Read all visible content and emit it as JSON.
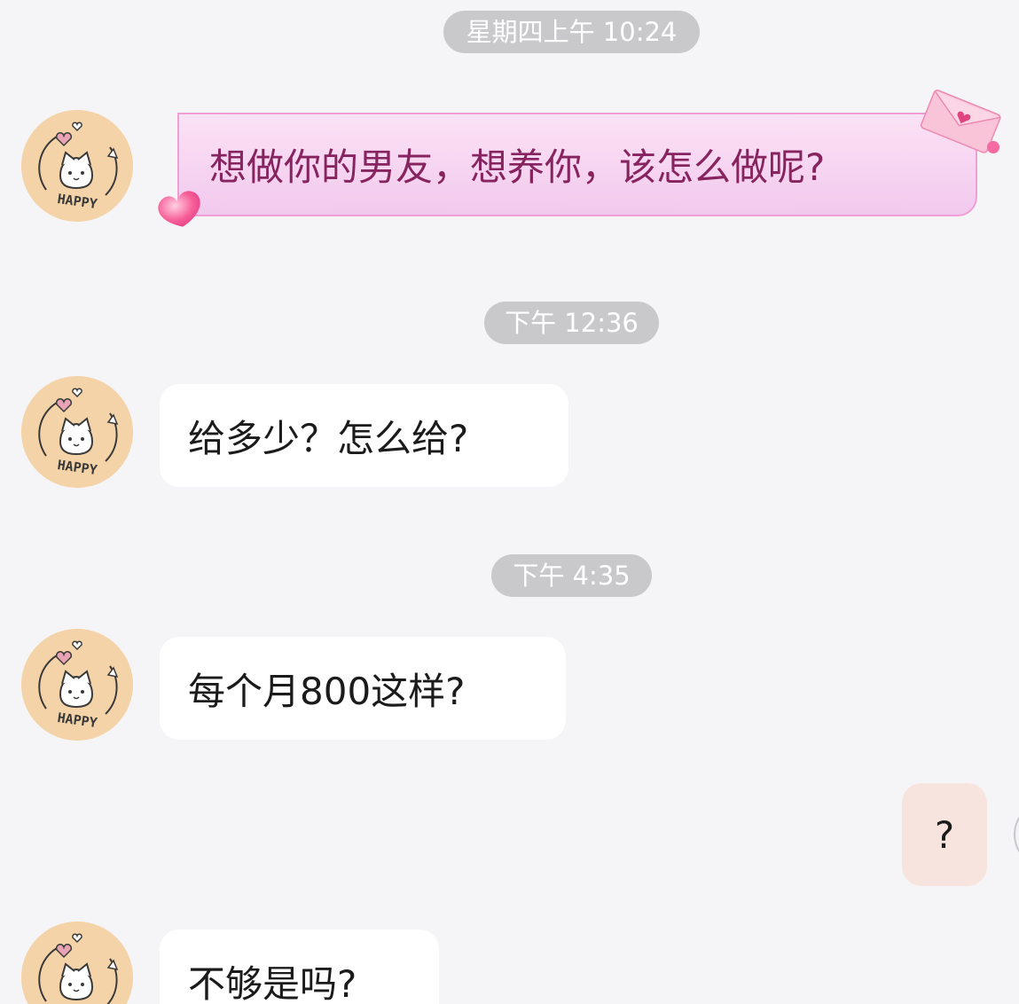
{
  "timestamps": {
    "t1": "星期四上午 10:24",
    "t2": "下午 12:36",
    "t3": "下午 4:35"
  },
  "messages": {
    "m1": "想做你的男友，想养你，该怎么做呢?",
    "m2": "给多少？怎么给?",
    "m3": "每个月800这样?",
    "m4": "?",
    "m5": "不够是吗?"
  },
  "contact": {
    "avatar_icon": "cat-happy-avatar-icon",
    "avatar_text": "HAPPY"
  },
  "colors": {
    "background": "#f5f5f7",
    "timestamp_pill": "#c9c9cb",
    "incoming_bubble": "#ffffff",
    "outgoing_bubble": "#f8e4df",
    "special_bubble_text": "#87245f",
    "avatar_bg": "#f5d3a8"
  }
}
